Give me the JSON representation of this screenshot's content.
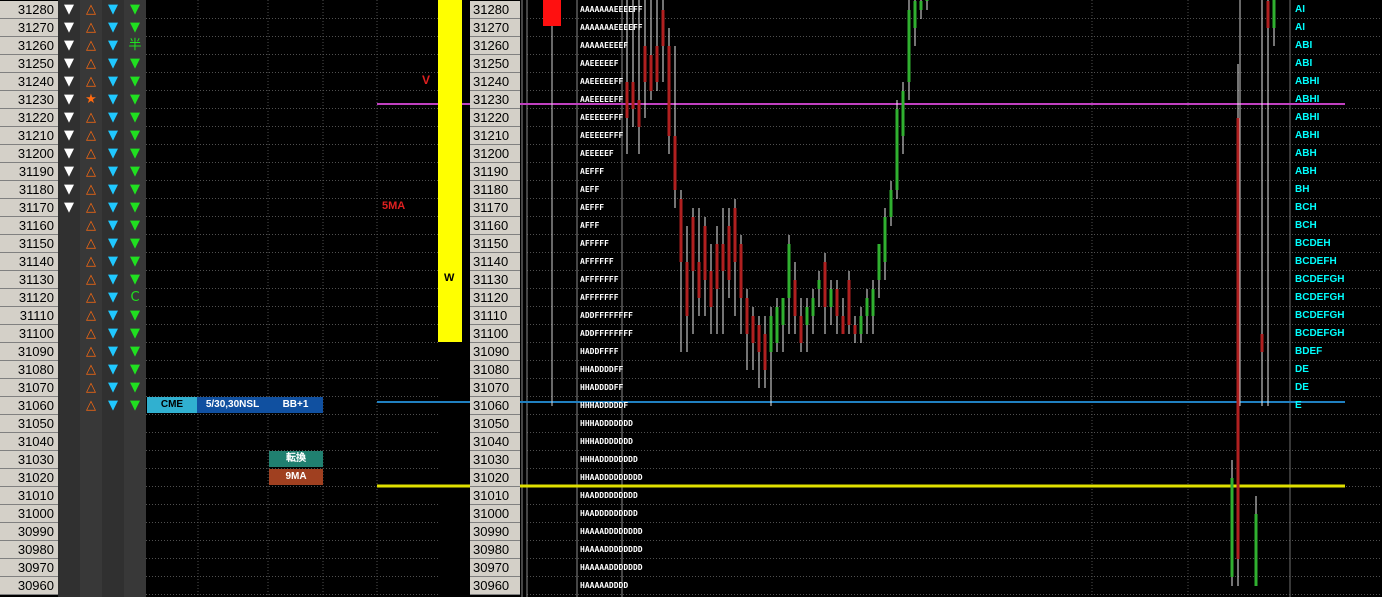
{
  "prices": [
    "31280",
    "31270",
    "31260",
    "31250",
    "31240",
    "31230",
    "31220",
    "31210",
    "31200",
    "31190",
    "31180",
    "31170",
    "31160",
    "31150",
    "31140",
    "31130",
    "31120",
    "31110",
    "31100",
    "31090",
    "31080",
    "31070",
    "31060",
    "31050",
    "31040",
    "31030",
    "31020",
    "31010",
    "31000",
    "30990",
    "30980",
    "30970",
    "30960"
  ],
  "signals": {
    "col1_white_down_rows": 12,
    "col2_special": {
      "row": 5,
      "symbol": "★"
    },
    "col2_orange_up_rows": 23,
    "col3_blue_down_rows": 23,
    "col4_green_down_rows": 23,
    "col4_special": [
      {
        "row": 2,
        "symbol": "半"
      },
      {
        "row": 16,
        "symbol": "C"
      }
    ]
  },
  "tags": {
    "cme": "CME",
    "nsl": "5/30,30NSL",
    "bb": "BB+1",
    "tenkan": "転換",
    "ma9": "9MA",
    "ma5": "5MA",
    "v_mark": "V",
    "w_mark": "W"
  },
  "tpo_rows": [
    "AAAAAAAEEEEFF",
    "AAAAAAAEEEEFF",
    "AAAAAEEEEF",
    "AAEEEEEF",
    "AAEEEEEFF",
    "AAEEEEEFF",
    "AEEEEEFFF",
    "AEEEEEFFF",
    "AEEEEEF",
    "AEFFF",
    "AEFF",
    "AEFFF",
    "AFFF",
    "AFFFFF",
    "AFFFFFF",
    "AFFFFFFF",
    "AFFFFFFF",
    "ADDFFFFFFFF",
    "ADDFFFFFFFF",
    "HADDFFFF",
    "HHADDDDFF",
    "HHADDDDFF",
    "HHHADDDDDF",
    "HHHADDDDDDD",
    "HHHADDDDDDD",
    "HHHADDDDDDDD",
    "HHAADDDDDDDDD",
    "HAADDDDDDDDD",
    "HAADDDDDDDDD",
    "HAAAADDDDDDDD",
    "HAAAADDDDDDDD",
    "HAAAAADDDDDDD",
    "HAAAAADDDD"
  ],
  "letter_labels": [
    "AI",
    "AI",
    "ABI",
    "ABI",
    "ABHI",
    "ABHI",
    "ABHI",
    "ABHI",
    "ABH",
    "ABH",
    "BH",
    "BCH",
    "BCH",
    "BCDEH",
    "BCDEFH",
    "BCDEFGH",
    "BCDEFGH",
    "BCDEFGH",
    "BCDEFGH",
    "BDEF",
    "DE",
    "DE",
    "E"
  ],
  "colors": {
    "magenta_line": "#c040c0",
    "yellow_line": "#e0e000",
    "blue_line": "#2080c0",
    "up": "#30b030",
    "down": "#b02020"
  },
  "chart_data": {
    "type": "candlestick",
    "title": "",
    "ylim": [
      30960,
      31280
    ],
    "candles": [
      {
        "x": 627,
        "o": 31240,
        "c": 31220,
        "h": 31290,
        "l": 31200
      },
      {
        "x": 633,
        "o": 31240,
        "c": 31225,
        "h": 31290,
        "l": 31215
      },
      {
        "x": 639,
        "o": 31230,
        "c": 31215,
        "h": 31290,
        "l": 31200
      },
      {
        "x": 645,
        "o": 31260,
        "c": 31240,
        "h": 31290,
        "l": 31220
      },
      {
        "x": 651,
        "o": 31255,
        "c": 31235,
        "h": 31290,
        "l": 31230
      },
      {
        "x": 657,
        "o": 31260,
        "c": 31240,
        "h": 31290,
        "l": 31235
      },
      {
        "x": 663,
        "o": 31280,
        "c": 31260,
        "h": 31290,
        "l": 31240
      },
      {
        "x": 669,
        "o": 31260,
        "c": 31210,
        "h": 31270,
        "l": 31200
      },
      {
        "x": 675,
        "o": 31210,
        "c": 31180,
        "h": 31260,
        "l": 31170
      },
      {
        "x": 681,
        "o": 31175,
        "c": 31140,
        "h": 31180,
        "l": 31090
      },
      {
        "x": 687,
        "o": 31140,
        "c": 31110,
        "h": 31160,
        "l": 31090
      },
      {
        "x": 693,
        "o": 31165,
        "c": 31135,
        "h": 31170,
        "l": 31100
      },
      {
        "x": 699,
        "o": 31140,
        "c": 31120,
        "h": 31170,
        "l": 31110
      },
      {
        "x": 705,
        "o": 31160,
        "c": 31130,
        "h": 31165,
        "l": 31110
      },
      {
        "x": 711,
        "o": 31135,
        "c": 31115,
        "h": 31150,
        "l": 31100
      },
      {
        "x": 717,
        "o": 31150,
        "c": 31125,
        "h": 31160,
        "l": 31100
      },
      {
        "x": 723,
        "o": 31150,
        "c": 31135,
        "h": 31170,
        "l": 31100
      },
      {
        "x": 729,
        "o": 31160,
        "c": 31130,
        "h": 31170,
        "l": 31120
      },
      {
        "x": 735,
        "o": 31170,
        "c": 31140,
        "h": 31175,
        "l": 31110
      },
      {
        "x": 741,
        "o": 31150,
        "c": 31120,
        "h": 31155,
        "l": 31100
      },
      {
        "x": 747,
        "o": 31120,
        "c": 31100,
        "h": 31125,
        "l": 31080
      },
      {
        "x": 753,
        "o": 31110,
        "c": 31095,
        "h": 31115,
        "l": 31080
      },
      {
        "x": 759,
        "o": 31105,
        "c": 31090,
        "h": 31110,
        "l": 31070
      },
      {
        "x": 765,
        "o": 31100,
        "c": 31080,
        "h": 31110,
        "l": 31070
      },
      {
        "x": 771,
        "o": 31090,
        "c": 31110,
        "h": 31115,
        "l": 31060
      },
      {
        "x": 777,
        "o": 31095,
        "c": 31115,
        "h": 31120,
        "l": 31090
      },
      {
        "x": 783,
        "o": 31105,
        "c": 31120,
        "h": 31120,
        "l": 31090
      },
      {
        "x": 789,
        "o": 31120,
        "c": 31150,
        "h": 31155,
        "l": 31100
      },
      {
        "x": 795,
        "o": 31130,
        "c": 31110,
        "h": 31140,
        "l": 31100
      },
      {
        "x": 801,
        "o": 31110,
        "c": 31095,
        "h": 31120,
        "l": 31090
      },
      {
        "x": 807,
        "o": 31105,
        "c": 31115,
        "h": 31120,
        "l": 31090
      },
      {
        "x": 813,
        "o": 31110,
        "c": 31120,
        "h": 31125,
        "l": 31100
      },
      {
        "x": 819,
        "o": 31125,
        "c": 31130,
        "h": 31135,
        "l": 31115
      },
      {
        "x": 825,
        "o": 31140,
        "c": 31115,
        "h": 31145,
        "l": 31100
      },
      {
        "x": 831,
        "o": 31115,
        "c": 31125,
        "h": 31130,
        "l": 31105
      },
      {
        "x": 837,
        "o": 31125,
        "c": 31110,
        "h": 31130,
        "l": 31100
      },
      {
        "x": 843,
        "o": 31110,
        "c": 31100,
        "h": 31120,
        "l": 31100
      },
      {
        "x": 849,
        "o": 31130,
        "c": 31105,
        "h": 31135,
        "l": 31100
      },
      {
        "x": 855,
        "o": 31105,
        "c": 31100,
        "h": 31110,
        "l": 31095
      },
      {
        "x": 861,
        "o": 31100,
        "c": 31110,
        "h": 31115,
        "l": 31095
      },
      {
        "x": 867,
        "o": 31110,
        "c": 31120,
        "h": 31125,
        "l": 31100
      },
      {
        "x": 873,
        "o": 31110,
        "c": 31125,
        "h": 31130,
        "l": 31100
      },
      {
        "x": 879,
        "o": 31130,
        "c": 31150,
        "h": 31150,
        "l": 31120
      },
      {
        "x": 885,
        "o": 31140,
        "c": 31165,
        "h": 31170,
        "l": 31130
      },
      {
        "x": 891,
        "o": 31165,
        "c": 31180,
        "h": 31185,
        "l": 31160
      },
      {
        "x": 897,
        "o": 31180,
        "c": 31225,
        "h": 31230,
        "l": 31175
      },
      {
        "x": 903,
        "o": 31210,
        "c": 31235,
        "h": 31240,
        "l": 31200
      },
      {
        "x": 909,
        "o": 31240,
        "c": 31280,
        "h": 31290,
        "l": 31230
      },
      {
        "x": 915,
        "o": 31270,
        "c": 31285,
        "h": 31290,
        "l": 31260
      },
      {
        "x": 921,
        "o": 31280,
        "c": 31285,
        "h": 31290,
        "l": 31275
      },
      {
        "x": 927,
        "o": 31285,
        "c": 31290,
        "h": 31290,
        "l": 31280
      },
      {
        "x": 1232,
        "o": 30965,
        "c": 31020,
        "h": 31030,
        "l": 30960
      },
      {
        "x": 1238,
        "o": 31220,
        "c": 30975,
        "h": 31250,
        "l": 30960
      },
      {
        "x": 1256,
        "o": 30960,
        "c": 31000,
        "h": 31010,
        "l": 30960
      },
      {
        "x": 1262,
        "o": 31100,
        "c": 31090,
        "h": 31290,
        "l": 31060
      },
      {
        "x": 1268,
        "o": 31285,
        "c": 31270,
        "h": 31290,
        "l": 31060
      },
      {
        "x": 1274,
        "o": 31270,
        "c": 31290,
        "h": 31290,
        "l": 31260
      }
    ]
  }
}
